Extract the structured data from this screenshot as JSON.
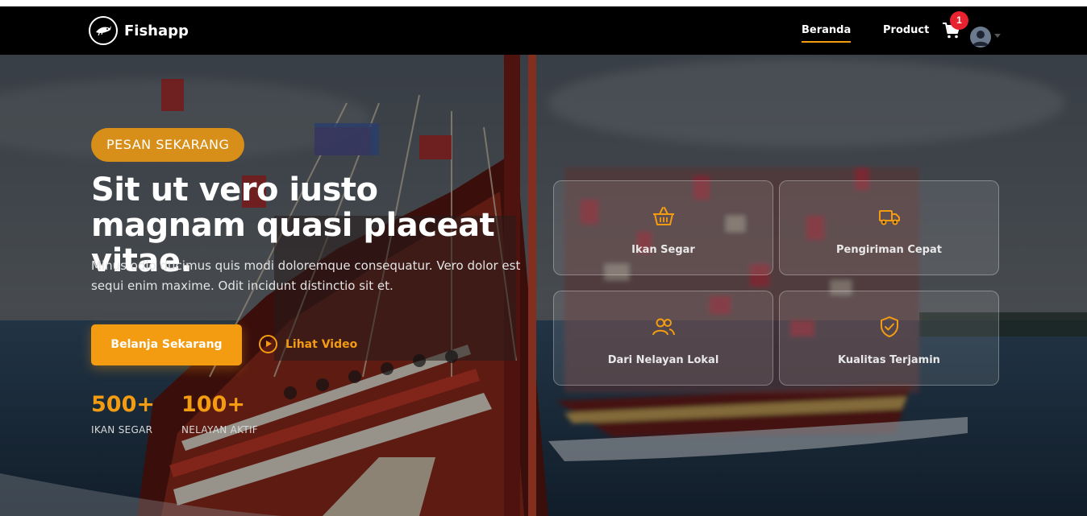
{
  "brand": {
    "name": "Fishapp",
    "logo_icon": "fish-logo-icon"
  },
  "nav": {
    "links": [
      {
        "label": "Beranda",
        "active": true
      },
      {
        "label": "Product",
        "active": false
      }
    ],
    "cart_count": "1",
    "cart_icon": "cart-icon",
    "user_icon": "user-avatar-icon"
  },
  "hero": {
    "badge": "PESAN SEKARANG",
    "headline": "Sit ut vero iusto magnam quasi placeat vitae.",
    "description": "Minus odio ducimus quis modi doloremque consequatur. Vero dolor est sequi enim maxime. Odit incidunt distinctio sit et.",
    "primary_button": "Belanja Sekarang",
    "video_button": "Lihat Video",
    "stats": [
      {
        "value": "500+",
        "label": "IKAN SEGAR"
      },
      {
        "value": "100+",
        "label": "NELAYAN AKTIF"
      }
    ],
    "features": [
      {
        "label": "Ikan Segar",
        "icon": "basket-icon"
      },
      {
        "label": "Pengiriman Cepat",
        "icon": "truck-icon"
      },
      {
        "label": "Dari Nelayan Lokal",
        "icon": "users-icon"
      },
      {
        "label": "Kualitas Terjamin",
        "icon": "shield-check-icon"
      }
    ]
  },
  "colors": {
    "accent": "#f39c12",
    "badge_bg": "#d88f1a",
    "cart_badge": "#e8222e",
    "navbar": "#000000"
  }
}
